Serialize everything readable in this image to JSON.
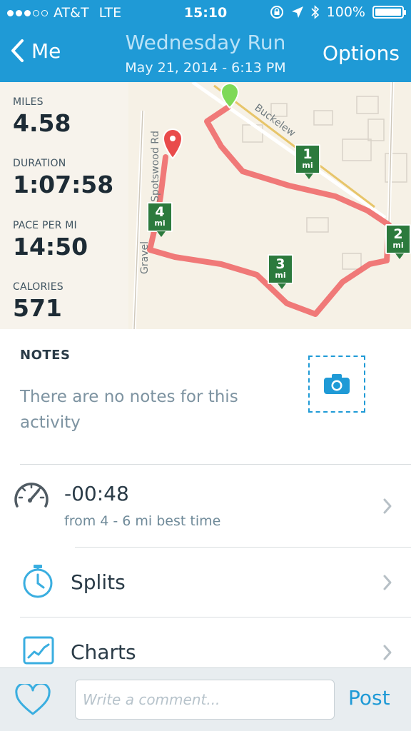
{
  "status_bar": {
    "carrier": "AT&T",
    "network": "LTE",
    "time": "15:10",
    "battery": "100%",
    "signal_bars": 3,
    "signal_total": 5
  },
  "nav": {
    "back_label": "Me",
    "title": "Wednesday Run",
    "subtitle": "May 21, 2014 - 6:13 PM",
    "options_label": "Options"
  },
  "stats": [
    {
      "label": "MILES",
      "value": "4.58"
    },
    {
      "label": "DURATION",
      "value": "1:07:58"
    },
    {
      "label": "PACE PER MI",
      "value": "14:50"
    },
    {
      "label": "CALORIES",
      "value": "571"
    }
  ],
  "map": {
    "road_labels": [
      "Buckelew",
      "Spotswood Rd",
      "Gravel"
    ],
    "markers": [
      {
        "num": "1",
        "unit": "mi"
      },
      {
        "num": "2",
        "unit": "mi"
      },
      {
        "num": "3",
        "unit": "mi"
      },
      {
        "num": "4",
        "unit": "mi"
      }
    ],
    "route_color": "#f06b6b",
    "end_pin_color": "#e94b4b",
    "start_pin_color": "#7ed957"
  },
  "notes": {
    "title": "NOTES",
    "empty_text": "There are no notes for this activity"
  },
  "rows": {
    "best_time": {
      "title": "-00:48",
      "subtitle": "from 4 - 6 mi best time",
      "icon": "speedometer-icon"
    },
    "splits": {
      "title": "Splits",
      "icon": "stopwatch-icon"
    },
    "charts": {
      "title": "Charts",
      "icon": "chart-icon"
    }
  },
  "bottom_bar": {
    "comment_placeholder": "Write a comment...",
    "post_label": "Post"
  },
  "colors": {
    "accent": "#1f9ad6",
    "header_bg": "#1f9ad6",
    "marker_green": "#2c7a3d"
  }
}
